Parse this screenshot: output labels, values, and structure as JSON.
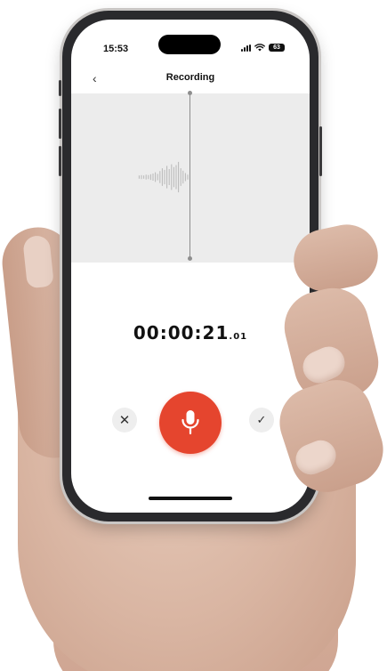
{
  "status_bar": {
    "time": "15:53",
    "battery": "63",
    "signal_icon": "signal-icon",
    "wifi_icon": "wifi-icon",
    "battery_icon": "battery-icon"
  },
  "header": {
    "back_icon": "chevron-left-icon",
    "back_glyph": "‹",
    "title": "Recording"
  },
  "timer": {
    "main": "00:00:21",
    "fraction": ".01"
  },
  "controls": {
    "cancel_icon": "close-icon",
    "cancel_glyph": "✕",
    "record_icon": "microphone-icon",
    "confirm_icon": "check-icon",
    "confirm_glyph": "✓"
  },
  "colors": {
    "record_button": "#e5452e",
    "waveform_panel": "#ececec",
    "waveform": "#b8b8b8"
  },
  "waveform": {
    "amplitudes": [
      0.04,
      0.05,
      0.04,
      0.06,
      0.05,
      0.07,
      0.09,
      0.12,
      0.08,
      0.15,
      0.22,
      0.18,
      0.28,
      0.2,
      0.32,
      0.25,
      0.3,
      0.38,
      0.22,
      0.16,
      0.1,
      0.06
    ]
  }
}
